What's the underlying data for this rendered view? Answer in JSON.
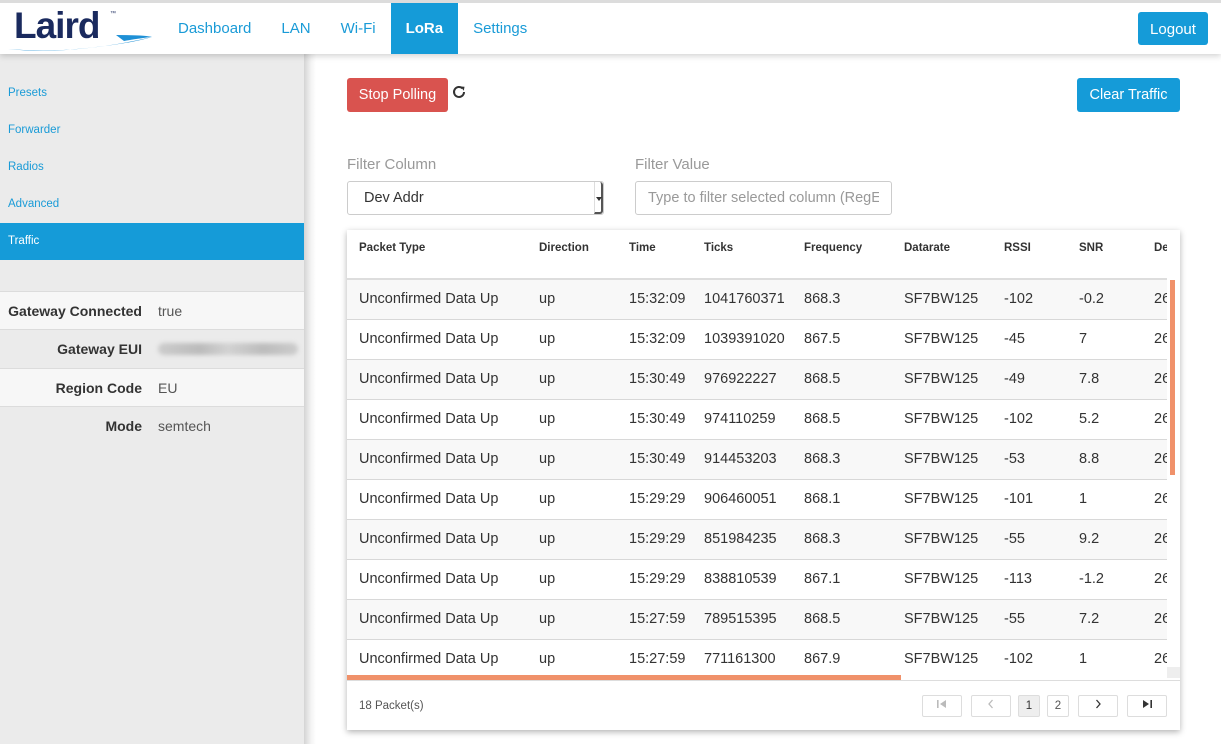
{
  "brand": {
    "name": "Laird",
    "trademark": "™"
  },
  "nav": {
    "items": [
      {
        "label": "Dashboard",
        "active": false
      },
      {
        "label": "LAN",
        "active": false
      },
      {
        "label": "Wi-Fi",
        "active": false
      },
      {
        "label": "LoRa",
        "active": true
      },
      {
        "label": "Settings",
        "active": false
      }
    ],
    "logout_label": "Logout"
  },
  "sidebar": {
    "items": [
      {
        "label": "Presets",
        "active": false
      },
      {
        "label": "Forwarder",
        "active": false
      },
      {
        "label": "Radios",
        "active": false
      },
      {
        "label": "Advanced",
        "active": false
      },
      {
        "label": "Traffic",
        "active": true
      }
    ],
    "info": [
      {
        "label": "Gateway Connected",
        "value": "true"
      },
      {
        "label": "Gateway EUI",
        "value": ""
      },
      {
        "label": "Region Code",
        "value": "EU"
      },
      {
        "label": "Mode",
        "value": "semtech"
      }
    ]
  },
  "toolbar": {
    "stop_polling_label": "Stop Polling",
    "clear_traffic_label": "Clear Traffic",
    "refresh_icon": "refresh-icon"
  },
  "filter": {
    "column_label": "Filter Column",
    "column_value": "Dev Addr",
    "value_label": "Filter Value",
    "value_placeholder": "Type to filter selected column (RegEx)",
    "value": ""
  },
  "table": {
    "columns": [
      "Packet Type",
      "Direction",
      "Time",
      "Ticks",
      "Frequency",
      "Datarate",
      "RSSI",
      "SNR",
      "Dev"
    ],
    "rows": [
      [
        "Unconfirmed Data Up",
        "up",
        "15:32:09",
        "1041760371",
        "868.3",
        "SF7BW125",
        "-102",
        "-0.2",
        "26"
      ],
      [
        "Unconfirmed Data Up",
        "up",
        "15:32:09",
        "1039391020",
        "867.5",
        "SF7BW125",
        "-45",
        "7",
        "26"
      ],
      [
        "Unconfirmed Data Up",
        "up",
        "15:30:49",
        "976922227",
        "868.5",
        "SF7BW125",
        "-49",
        "7.8",
        "26"
      ],
      [
        "Unconfirmed Data Up",
        "up",
        "15:30:49",
        "974110259",
        "868.5",
        "SF7BW125",
        "-102",
        "5.2",
        "26"
      ],
      [
        "Unconfirmed Data Up",
        "up",
        "15:30:49",
        "914453203",
        "868.3",
        "SF7BW125",
        "-53",
        "8.8",
        "26"
      ],
      [
        "Unconfirmed Data Up",
        "up",
        "15:29:29",
        "906460051",
        "868.1",
        "SF7BW125",
        "-101",
        "1",
        "26"
      ],
      [
        "Unconfirmed Data Up",
        "up",
        "15:29:29",
        "851984235",
        "868.3",
        "SF7BW125",
        "-55",
        "9.2",
        "26"
      ],
      [
        "Unconfirmed Data Up",
        "up",
        "15:29:29",
        "838810539",
        "867.1",
        "SF7BW125",
        "-113",
        "-1.2",
        "26"
      ],
      [
        "Unconfirmed Data Up",
        "up",
        "15:27:59",
        "789515395",
        "868.5",
        "SF7BW125",
        "-55",
        "7.2",
        "26"
      ],
      [
        "Unconfirmed Data Up",
        "up",
        "15:27:59",
        "771161300",
        "867.9",
        "SF7BW125",
        "-102",
        "1",
        "26"
      ]
    ],
    "count_label": "18 Packet(s)",
    "pagination": {
      "first_icon": "first-page-icon",
      "prev_icon": "prev-page-icon",
      "pages": [
        "1",
        "2"
      ],
      "current_page": "1",
      "next_icon": "next-page-icon",
      "last_icon": "last-page-icon"
    }
  },
  "colors": {
    "brand_blue": "#159bd8",
    "danger_red": "#d9534f",
    "scrollbar_orange": "#f0916a",
    "logo_navy": "#1a2a5e"
  }
}
